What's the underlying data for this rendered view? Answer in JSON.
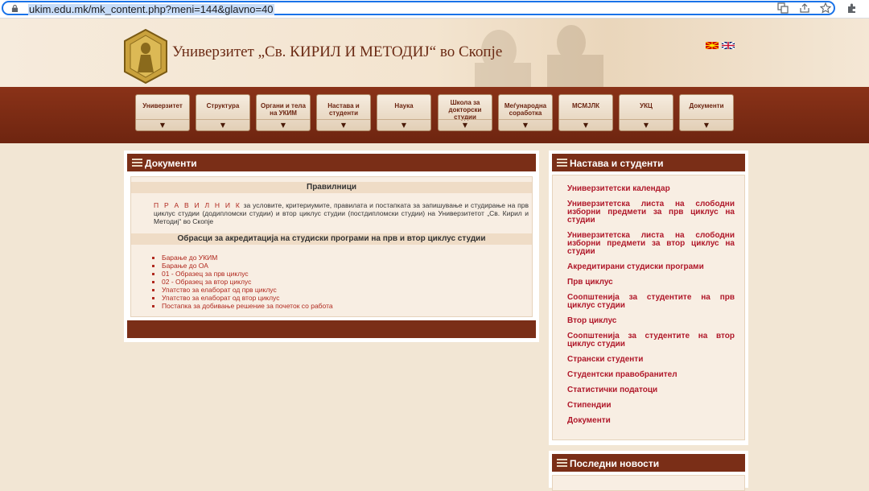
{
  "browser": {
    "url": "ukim.edu.mk/mk_content.php?meni=144&glavno=40"
  },
  "header": {
    "title": "Универзитет „Св. КИРИЛ И МЕТОДИЈ“ во Скопје"
  },
  "nav": {
    "items": [
      {
        "label": "Универзитет"
      },
      {
        "label": "Структура"
      },
      {
        "label": "Органи и тела на УКИМ"
      },
      {
        "label": "Настава и студенти"
      },
      {
        "label": "Наука"
      },
      {
        "label": "Школа за докторски студии"
      },
      {
        "label": "Меѓународна соработка"
      },
      {
        "label": "МСМЈЛК"
      },
      {
        "label": "УКЦ"
      },
      {
        "label": "Документи"
      }
    ],
    "arrow": "▼"
  },
  "main": {
    "title": "Документи",
    "rules_heading": "Правилници",
    "rules_link": "П Р А В И Л Н И К",
    "rules_text": " за условите, критериумите, правилата и постапката за запишување и студирање на прв циклус студии (додипломски студии) и втор циклус студии (постдипломски студии) на Универзитетот „Св. Кирил и Методиј“ во Скопје",
    "forms_heading": "Обрасци за акредитација на студиски програми на прв и втор циклус студии",
    "forms": [
      "Барање до УКИМ",
      "Барање до ОА",
      "01 - Образец за прв циклус",
      "02 - Образец за втор циклус",
      "Упатство за елаборат од прв циклус",
      "Упатство за елаборат од втор циклус",
      "Постапка за добивање решение за почеток со работа"
    ]
  },
  "sidebar": {
    "title": "Настава и студенти",
    "links": [
      "Универзитетски календар",
      "Универзитетска листа на слободни изборни предмети за прв циклус на студии",
      "Универзитетска листа на слободни изборни предмети за втор циклус на студии",
      "Акредитирани студиски програми",
      "Прв циклус",
      "Соопштенија за студентите на прв циклус студии",
      "Втор циклус",
      "Соопштенија за студентите на втор циклус студии",
      "Странски студенти",
      "Студентски правобранител",
      "Статистички податоци",
      "Стипендии",
      "Документи"
    ],
    "news_title": "Последни новости"
  }
}
